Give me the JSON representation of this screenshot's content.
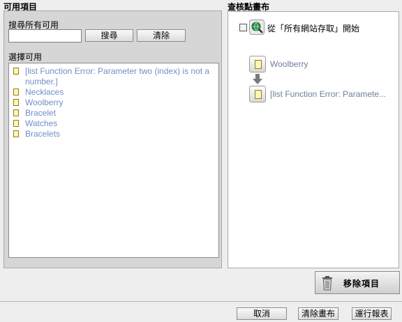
{
  "left": {
    "title": "可用項目",
    "search_label": "搜尋所有可用",
    "search_value": "",
    "search_button": "搜尋",
    "clear_button": "清除",
    "select_label": "選擇可用",
    "items": [
      {
        "label": "[list Function Error: Parameter two (index) is not a number.]"
      },
      {
        "label": "Necklaces"
      },
      {
        "label": "Woolberry"
      },
      {
        "label": "Bracelet"
      },
      {
        "label": "Watches"
      },
      {
        "label": "Bracelets"
      }
    ]
  },
  "right": {
    "title": "查核點畫布",
    "start_label": "從「所有網站存取」開始",
    "nodes": [
      {
        "label": "Woolberry"
      },
      {
        "label": "[list Function Error: Paramete..."
      }
    ],
    "remove_button": "移除項目"
  },
  "footer": {
    "cancel_button": "取消",
    "clear_canvas_button": "清除畫布",
    "run_report_button": "運行報表"
  }
}
